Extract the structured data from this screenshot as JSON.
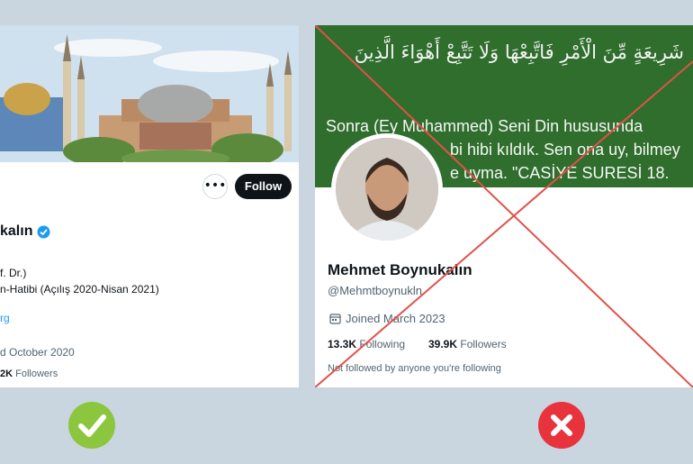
{
  "left_profile": {
    "name": "kalın",
    "bio_line1": "f. Dr.)",
    "bio_line2": "n-Hatibi (Açılış 2020-Nisan 2021)",
    "link": "rg",
    "joined": "d October 2020",
    "followers_count": "2K",
    "followers_label": "Followers",
    "more_label": "•••",
    "follow_label": "Follow",
    "verified_icon": "verified-badge-icon"
  },
  "right_profile": {
    "banner_arabic": "شَرِيعَةٍ مِّنَ الْأَمْرِ فَاتَّبِعْهَا وَلَا تَتَّبِعْ أَهْوَاءَ الَّذِينَ",
    "banner_line1": "Sonra (Ey Muhammed) Seni Din hususunda",
    "banner_line2": "bi        hibi kıldık. Sen ona uy, bilmey",
    "banner_line3": "e uyma. \"CASİYE SURESİ 18.",
    "name": "Mehmet Boynukalın",
    "handle": "@Mehmtboynukln",
    "joined": "Joined March 2023",
    "following_count": "13.3K",
    "following_label": "Following",
    "followers_count": "39.9K",
    "followers_label": "Followers",
    "not_followed": "Not followed by anyone you're following"
  },
  "verdicts": {
    "left": "check-icon",
    "right": "cross-icon",
    "colors": {
      "check": "#8cc63f",
      "cross": "#e8323c",
      "strike": "#e0524a",
      "banner_green": "#2f6e2c"
    }
  }
}
